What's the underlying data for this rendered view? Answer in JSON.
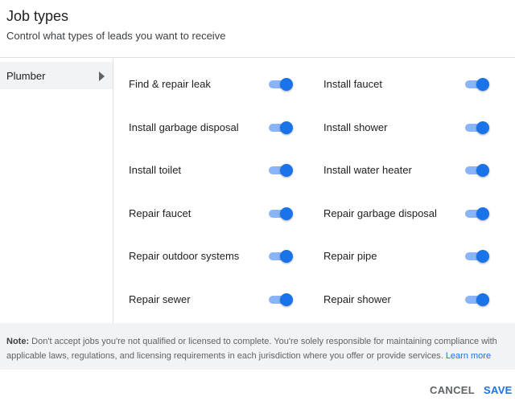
{
  "header": {
    "title": "Job types",
    "subtitle": "Control what types of leads you want to receive"
  },
  "sidebar": {
    "items": [
      {
        "label": "Plumber",
        "selected": true
      }
    ]
  },
  "job_types": {
    "left": [
      {
        "label": "Find & repair leak",
        "enabled": true
      },
      {
        "label": "Install garbage disposal",
        "enabled": true
      },
      {
        "label": "Install toilet",
        "enabled": true
      },
      {
        "label": "Repair faucet",
        "enabled": true
      },
      {
        "label": "Repair outdoor systems",
        "enabled": true
      },
      {
        "label": "Repair sewer",
        "enabled": true
      }
    ],
    "right": [
      {
        "label": "Install faucet",
        "enabled": true
      },
      {
        "label": "Install shower",
        "enabled": true
      },
      {
        "label": "Install water heater",
        "enabled": true
      },
      {
        "label": "Repair garbage disposal",
        "enabled": true
      },
      {
        "label": "Repair pipe",
        "enabled": true
      },
      {
        "label": "Repair shower",
        "enabled": true
      }
    ]
  },
  "note": {
    "prefix": "Note:",
    "text": " Don't accept jobs you're not qualified or licensed to complete. You're solely responsible for maintaining compliance with applicable laws, regulations, and licensing requirements in each jurisdiction where you offer or provide services. ",
    "link": "Learn more"
  },
  "footer": {
    "cancel_label": "CANCEL",
    "save_label": "SAVE"
  },
  "colors": {
    "accent": "#1a73e8",
    "toggle_track": "#8ab4f8",
    "panel_bg": "#f1f3f4"
  },
  "icons": {
    "sidebar_chevron": "chevron-right-icon"
  }
}
